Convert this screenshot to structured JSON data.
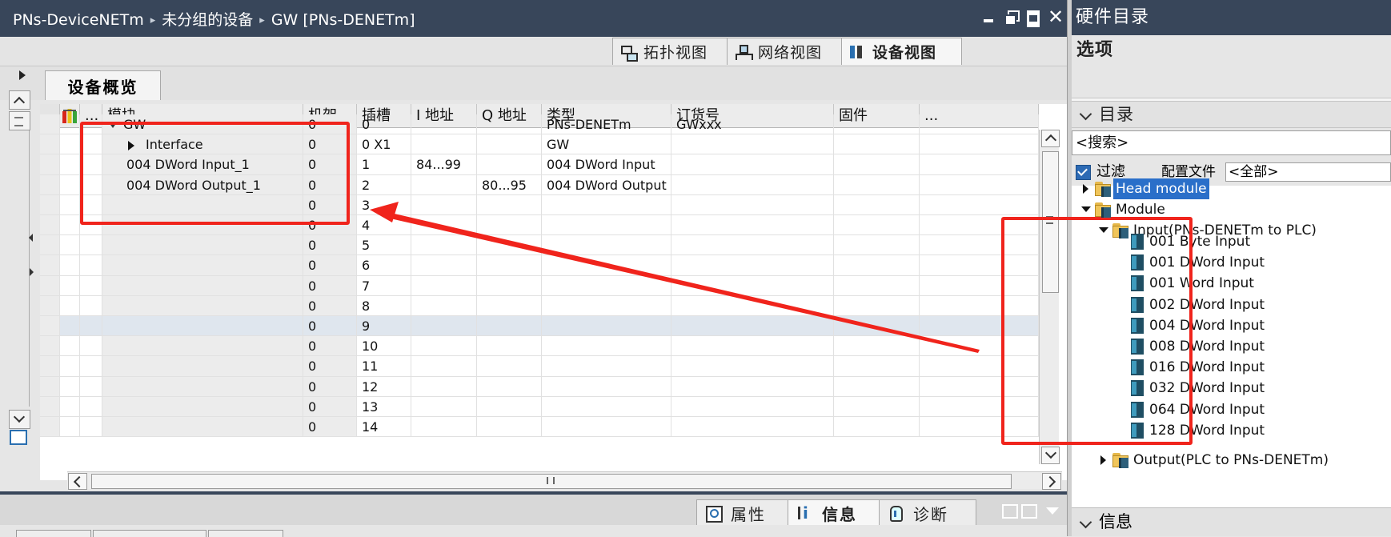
{
  "editor": {
    "breadcrumb": [
      "PNs-DeviceNETm",
      "未分组的设备",
      "GW [PNs-DENETm]"
    ],
    "view_tabs": [
      {
        "label": "拓扑视图",
        "icon": "topology-icon"
      },
      {
        "label": "网络视图",
        "icon": "network-icon"
      },
      {
        "label": "设备视图",
        "icon": "device-icon",
        "active": true
      }
    ],
    "overview_tab": "设备概览",
    "columns": [
      "...",
      "模块",
      "机架",
      "插槽",
      "I 地址",
      "Q 地址",
      "类型",
      "订货号",
      "固件",
      "..."
    ],
    "rows": [
      {
        "module": "GW",
        "rack": "0",
        "slot": "0",
        "i_addr": "",
        "q_addr": "",
        "type": "PNs-DENETm",
        "order": "GWxxx",
        "fw": ""
      },
      {
        "module": "Interface",
        "rack": "0",
        "slot": "0 X1",
        "i_addr": "",
        "q_addr": "",
        "type": "GW",
        "order": "",
        "fw": ""
      },
      {
        "module": "004 DWord Input_1",
        "rack": "0",
        "slot": "1",
        "i_addr": "84...99",
        "q_addr": "",
        "type": "004 DWord Input",
        "order": "",
        "fw": ""
      },
      {
        "module": "004 DWord Output_1",
        "rack": "0",
        "slot": "2",
        "i_addr": "",
        "q_addr": "80...95",
        "type": "004 DWord Output",
        "order": "",
        "fw": ""
      },
      {
        "module": "",
        "rack": "0",
        "slot": "3",
        "i_addr": "",
        "q_addr": "",
        "type": "",
        "order": "",
        "fw": ""
      },
      {
        "module": "",
        "rack": "0",
        "slot": "4",
        "i_addr": "",
        "q_addr": "",
        "type": "",
        "order": "",
        "fw": ""
      },
      {
        "module": "",
        "rack": "0",
        "slot": "5",
        "i_addr": "",
        "q_addr": "",
        "type": "",
        "order": "",
        "fw": ""
      },
      {
        "module": "",
        "rack": "0",
        "slot": "6",
        "i_addr": "",
        "q_addr": "",
        "type": "",
        "order": "",
        "fw": ""
      },
      {
        "module": "",
        "rack": "0",
        "slot": "7",
        "i_addr": "",
        "q_addr": "",
        "type": "",
        "order": "",
        "fw": ""
      },
      {
        "module": "",
        "rack": "0",
        "slot": "8",
        "i_addr": "",
        "q_addr": "",
        "type": "",
        "order": "",
        "fw": ""
      },
      {
        "module": "",
        "rack": "0",
        "slot": "9",
        "i_addr": "",
        "q_addr": "",
        "type": "",
        "order": "",
        "fw": "",
        "selected": true
      },
      {
        "module": "",
        "rack": "0",
        "slot": "10",
        "i_addr": "",
        "q_addr": "",
        "type": "",
        "order": "",
        "fw": ""
      },
      {
        "module": "",
        "rack": "0",
        "slot": "11",
        "i_addr": "",
        "q_addr": "",
        "type": "",
        "order": "",
        "fw": ""
      },
      {
        "module": "",
        "rack": "0",
        "slot": "12",
        "i_addr": "",
        "q_addr": "",
        "type": "",
        "order": "",
        "fw": ""
      },
      {
        "module": "",
        "rack": "0",
        "slot": "13",
        "i_addr": "",
        "q_addr": "",
        "type": "",
        "order": "",
        "fw": ""
      },
      {
        "module": "",
        "rack": "0",
        "slot": "14",
        "i_addr": "",
        "q_addr": "",
        "type": "",
        "order": "",
        "fw": ""
      }
    ],
    "bottom_tabs": [
      {
        "label": "属性",
        "icon": "properties-icon"
      },
      {
        "label": "信息",
        "icon": "info-icon",
        "active": true
      },
      {
        "label": "诊断",
        "icon": "diagnostics-icon"
      }
    ]
  },
  "catalog": {
    "title": "硬件目录",
    "options": "选项",
    "section": "目录",
    "search_placeholder": "<搜索>",
    "filter_label": "过滤",
    "profile_label": "配置文件",
    "profile_value": "<全部>",
    "head_module": "Head module",
    "module": "Module",
    "input_group": "Input(PNs-DENETm to PLC)",
    "input_items": [
      "001 Byte Input",
      "001 DWord Input",
      "001 Word Input",
      "002 DWord Input",
      "004 DWord Input",
      "008 DWord Input",
      "016 DWord Input",
      "032 DWord Input",
      "064 DWord Input",
      "128 DWord Input"
    ],
    "output_group": "Output(PLC to PNs-DENETm)",
    "bottom_section": "信息"
  },
  "colors": {
    "title_bar": "#38465a",
    "annotation_red": "#f0241c",
    "selection_blue": "#2a6fc9"
  }
}
